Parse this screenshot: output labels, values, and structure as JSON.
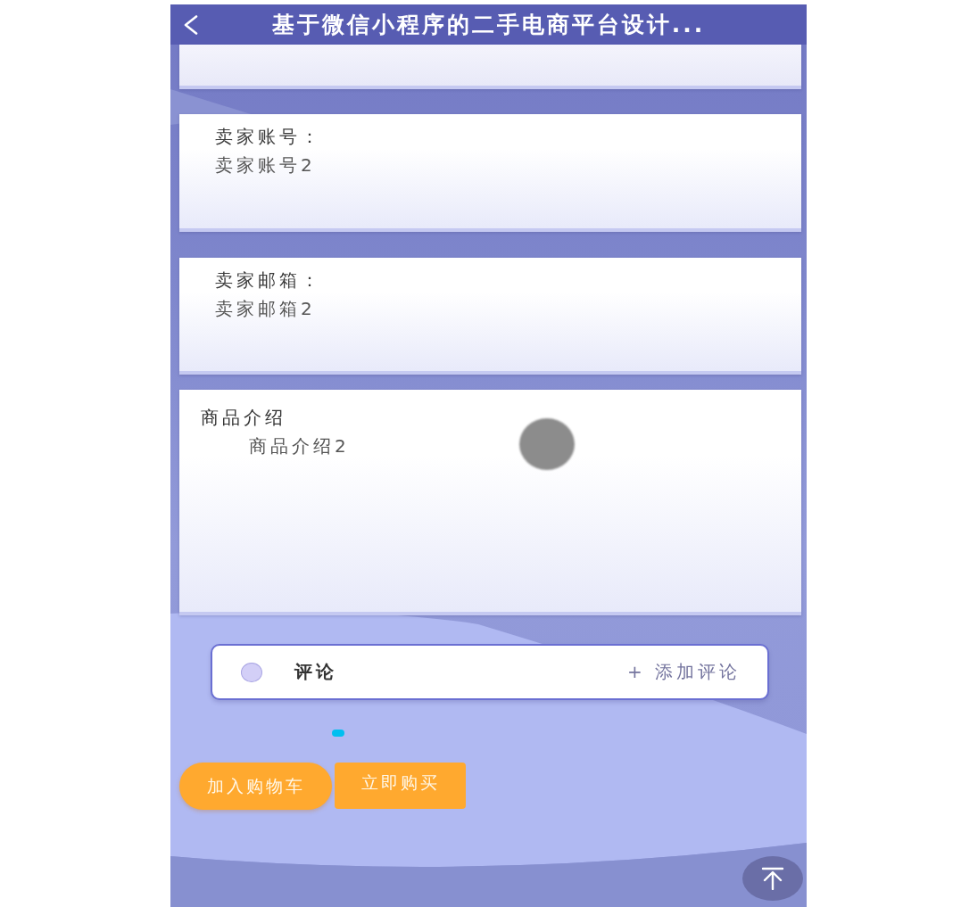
{
  "header": {
    "title": "基于微信小程序的二手电商平台设计..."
  },
  "cards": [
    {
      "kind": "blank"
    },
    {
      "kind": "field",
      "label": "卖家账号：",
      "value": "卖家账号2"
    },
    {
      "kind": "field",
      "label": "卖家邮箱：",
      "value": "卖家邮箱2"
    },
    {
      "kind": "intro",
      "label": "商品介绍",
      "value": "商品介绍2"
    }
  ],
  "comments": {
    "title": "评论",
    "add_label": "+ 添加评论"
  },
  "buttons": [
    {
      "kind": "pill",
      "label": "加入购物车"
    },
    {
      "kind": "square",
      "label": "立即购买"
    }
  ]
}
